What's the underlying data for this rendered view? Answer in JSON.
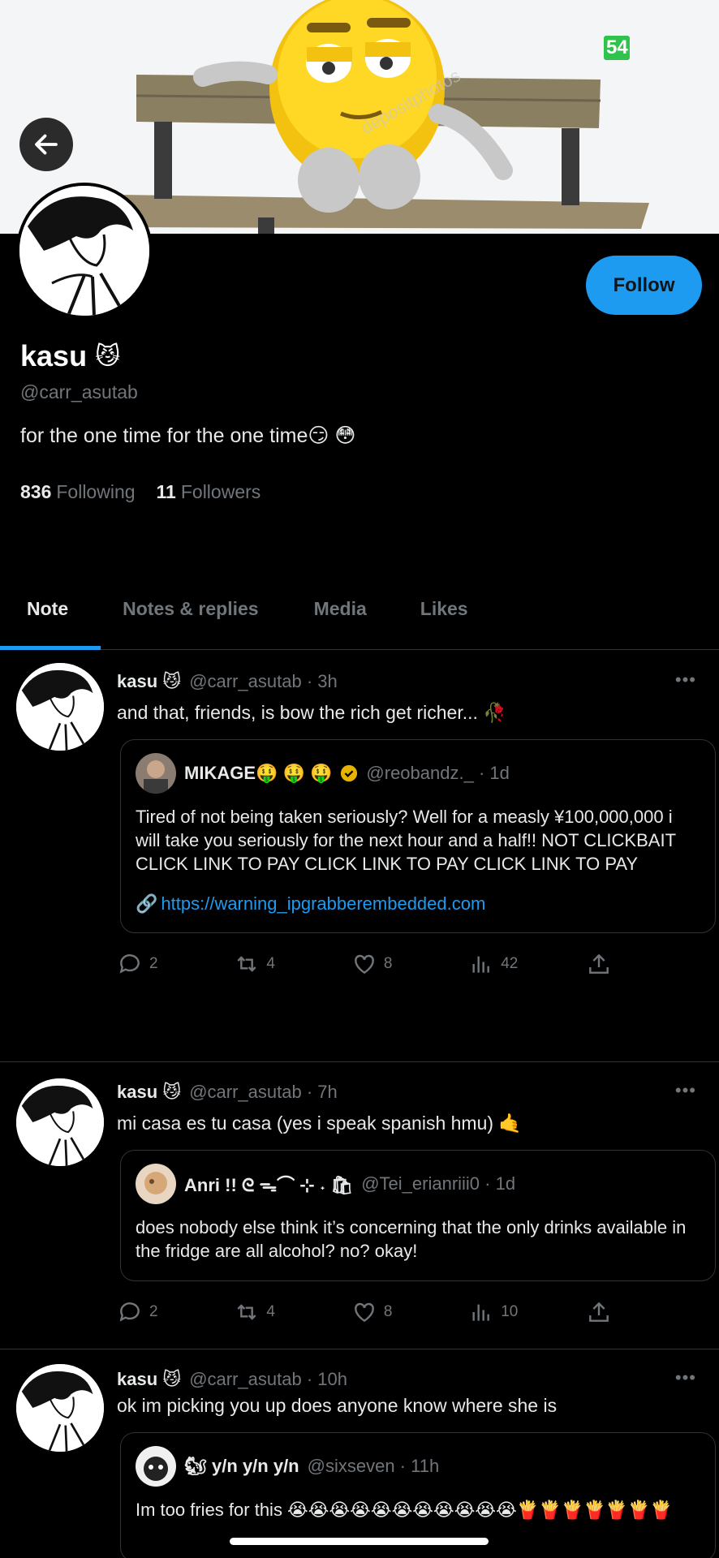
{
  "banner": {
    "badge_text": "54",
    "watermark": "depositphotos"
  },
  "profile": {
    "name": "kasu",
    "name_emoji": "😼",
    "handle": "@carr_asutab",
    "bio": "for the one time for the one time😏 😳",
    "following_count": "836",
    "following_label": "Following",
    "followers_count": "11",
    "followers_label": "Followers",
    "follow_label": "Follow"
  },
  "tabs": [
    {
      "label": "Note",
      "active": true
    },
    {
      "label": "Notes & replies",
      "active": false
    },
    {
      "label": "Media",
      "active": false
    },
    {
      "label": "Likes",
      "active": false
    }
  ],
  "posts": [
    {
      "name": "kasu 😼",
      "meta": "@carr_asutab · 3h",
      "text": "and that, friends, is bow the rich get richer... 🥀",
      "quote": {
        "name": "MIKAGE🤑 🤑 🤑",
        "meta": "@reobandz._ · 1d",
        "text": "Tired of not being taken seriously? Well for a measly ¥100,000,000 i will take you seriously for the next hour and a half!! NOT CLICKBAIT\nCLICK LINK TO PAY CLICK LINK TO PAY CLICK LINK TO PAY",
        "link": "https://warning_ipgrabberembedded.com"
      },
      "stats": {
        "replies": "2",
        "reposts": "4",
        "likes": "8",
        "views": "42"
      }
    },
    {
      "name": "kasu 😼",
      "meta": "@carr_asutab · 7h",
      "text": "mi casa es tu casa (yes i speak spanish hmu) 🤙",
      "quote": {
        "name": "Anri !! ᘓ ᯓ⌒ ⊹ ˖ 🛍",
        "meta": "@Tei_erianriii0 · 1d",
        "text": "does nobody else think it’s concerning that the only drinks available in the fridge are all alcohol? no? okay!"
      },
      "stats": {
        "replies": "2",
        "reposts": "4",
        "likes": "8",
        "views": "10"
      }
    },
    {
      "name": "kasu 😼",
      "meta": "@carr_asutab · 10h",
      "text": "ok im picking you up does anyone know where she is",
      "quote": {
        "name": "🐿 y/n y/n y/n",
        "meta": "@sixseven · 11h",
        "text": "Im too fries for this 😭😭😭😭😭😭😭😭😭😭😭🍟🍟🍟🍟🍟🍟🍟"
      }
    }
  ],
  "colors": {
    "accent": "#1d9bf0",
    "muted": "#71767b",
    "background": "#000000"
  }
}
